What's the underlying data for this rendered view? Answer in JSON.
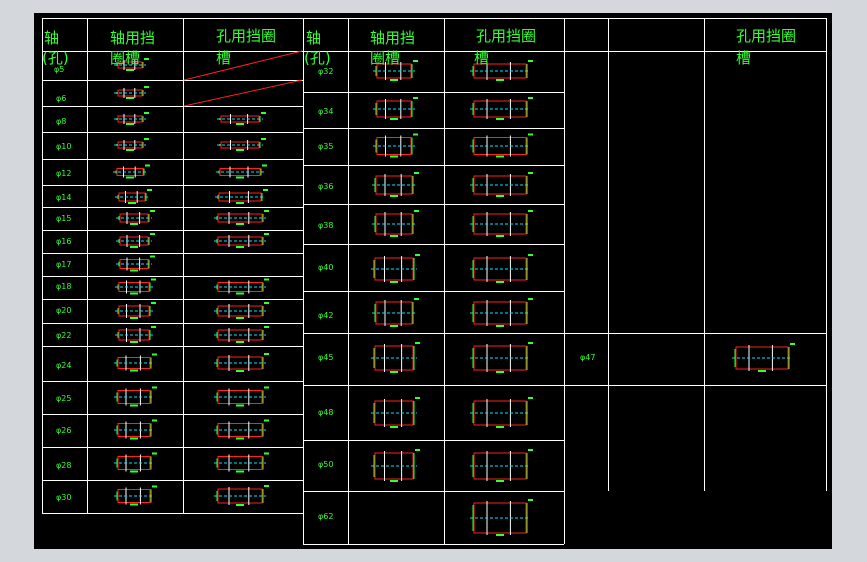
{
  "colors": {
    "background": "#000000",
    "frame": "#d4d8dd",
    "grid": "#ffffff",
    "text": "#33ff33",
    "part": "#ff2020",
    "center": "#00e5ff"
  },
  "table1": {
    "headers": {
      "col1": "轴",
      "col1b": "(孔)",
      "col2": "轴用挡",
      "col2b": "圈槽",
      "col3": "孔用挡圈",
      "col3b": "槽"
    },
    "rows": [
      "φ5",
      "φ6",
      "φ8",
      "φ10",
      "φ12",
      "φ14",
      "φ15",
      "φ16",
      "φ17",
      "φ18",
      "φ20",
      "φ22",
      "φ24",
      "φ25",
      "φ26",
      "φ28",
      "φ30"
    ]
  },
  "table2": {
    "headers": {
      "col1": "轴",
      "col1b": "(孔)",
      "col2": "轴用挡",
      "col2b": "圈槽",
      "col3": "孔用挡圈",
      "col3b": "槽"
    },
    "rows": [
      "φ32",
      "φ34",
      "φ35",
      "φ36",
      "φ38",
      "φ40",
      "φ42",
      "φ45",
      "φ48",
      "φ50",
      "φ62"
    ]
  },
  "table3": {
    "headers": {
      "col3": "孔用挡圈",
      "col3b": "槽"
    },
    "rows": [
      "φ47"
    ]
  }
}
